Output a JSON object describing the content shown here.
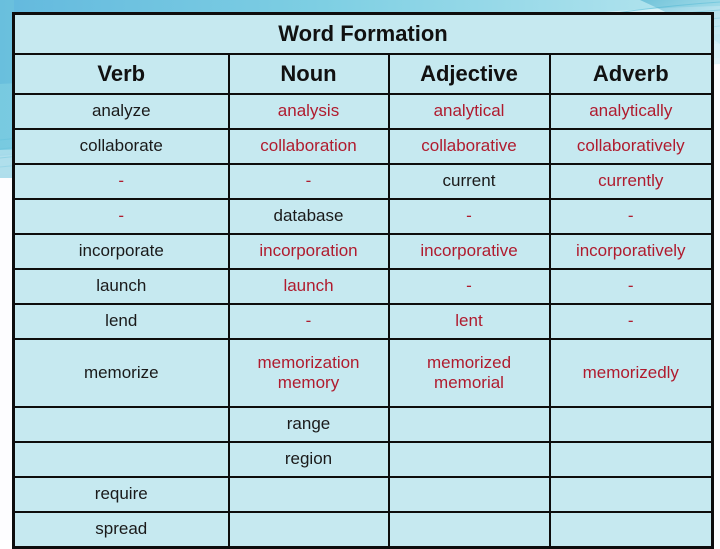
{
  "slide": {
    "title": "Word Formation",
    "accent_color": "#4fc3d9",
    "table_fill": "#c6e9f0",
    "given_word_color": "#1a1a1a",
    "derived_word_color": "#b01b2e",
    "border_color": "#0d0d0d"
  },
  "table": {
    "columns": [
      "Verb",
      "Noun",
      "Adjective",
      "Adverb"
    ],
    "rows": [
      {
        "verb": {
          "lines": [
            "analyze"
          ],
          "color": "black"
        },
        "noun": {
          "lines": [
            "analysis"
          ],
          "color": "red"
        },
        "adjective": {
          "lines": [
            "analytical"
          ],
          "color": "red"
        },
        "adverb": {
          "lines": [
            "analytically"
          ],
          "color": "red"
        }
      },
      {
        "verb": {
          "lines": [
            "collaborate"
          ],
          "color": "black"
        },
        "noun": {
          "lines": [
            "collaboration"
          ],
          "color": "red"
        },
        "adjective": {
          "lines": [
            "collaborative"
          ],
          "color": "red"
        },
        "adverb": {
          "lines": [
            "collaboratively"
          ],
          "color": "red"
        }
      },
      {
        "verb": {
          "lines": [
            "-"
          ],
          "color": "red"
        },
        "noun": {
          "lines": [
            "-"
          ],
          "color": "red"
        },
        "adjective": {
          "lines": [
            "current"
          ],
          "color": "black"
        },
        "adverb": {
          "lines": [
            "currently"
          ],
          "color": "red"
        }
      },
      {
        "verb": {
          "lines": [
            "-"
          ],
          "color": "red"
        },
        "noun": {
          "lines": [
            "database"
          ],
          "color": "black"
        },
        "adjective": {
          "lines": [
            "-"
          ],
          "color": "red"
        },
        "adverb": {
          "lines": [
            "-"
          ],
          "color": "red"
        }
      },
      {
        "verb": {
          "lines": [
            "incorporate"
          ],
          "color": "black"
        },
        "noun": {
          "lines": [
            "incorporation"
          ],
          "color": "red"
        },
        "adjective": {
          "lines": [
            "incorporative"
          ],
          "color": "red"
        },
        "adverb": {
          "lines": [
            "incorporatively"
          ],
          "color": "red"
        }
      },
      {
        "verb": {
          "lines": [
            "launch"
          ],
          "color": "black"
        },
        "noun": {
          "lines": [
            "launch"
          ],
          "color": "red"
        },
        "adjective": {
          "lines": [
            "-"
          ],
          "color": "red"
        },
        "adverb": {
          "lines": [
            "-"
          ],
          "color": "red"
        }
      },
      {
        "verb": {
          "lines": [
            "lend"
          ],
          "color": "black"
        },
        "noun": {
          "lines": [
            "-"
          ],
          "color": "red"
        },
        "adjective": {
          "lines": [
            "lent"
          ],
          "color": "red"
        },
        "adverb": {
          "lines": [
            "-"
          ],
          "color": "red"
        }
      },
      {
        "tall": true,
        "verb": {
          "lines": [
            "memorize"
          ],
          "color": "black"
        },
        "noun": {
          "lines": [
            "memorization",
            "memory"
          ],
          "color": "red"
        },
        "adjective": {
          "lines": [
            "memorized",
            "memorial"
          ],
          "color": "red"
        },
        "adverb": {
          "lines": [
            "memorizedly"
          ],
          "color": "red"
        }
      },
      {
        "verb": {
          "lines": [
            ""
          ],
          "color": "black"
        },
        "noun": {
          "lines": [
            "range"
          ],
          "color": "black"
        },
        "adjective": {
          "lines": [
            ""
          ],
          "color": "black"
        },
        "adverb": {
          "lines": [
            ""
          ],
          "color": "black"
        }
      },
      {
        "verb": {
          "lines": [
            ""
          ],
          "color": "black"
        },
        "noun": {
          "lines": [
            "region"
          ],
          "color": "black"
        },
        "adjective": {
          "lines": [
            ""
          ],
          "color": "black"
        },
        "adverb": {
          "lines": [
            ""
          ],
          "color": "black"
        }
      },
      {
        "verb": {
          "lines": [
            "require"
          ],
          "color": "black"
        },
        "noun": {
          "lines": [
            ""
          ],
          "color": "black"
        },
        "adjective": {
          "lines": [
            ""
          ],
          "color": "black"
        },
        "adverb": {
          "lines": [
            ""
          ],
          "color": "black"
        }
      },
      {
        "verb": {
          "lines": [
            "spread"
          ],
          "color": "black"
        },
        "noun": {
          "lines": [
            ""
          ],
          "color": "black"
        },
        "adjective": {
          "lines": [
            ""
          ],
          "color": "black"
        },
        "adverb": {
          "lines": [
            ""
          ],
          "color": "black"
        }
      }
    ]
  }
}
